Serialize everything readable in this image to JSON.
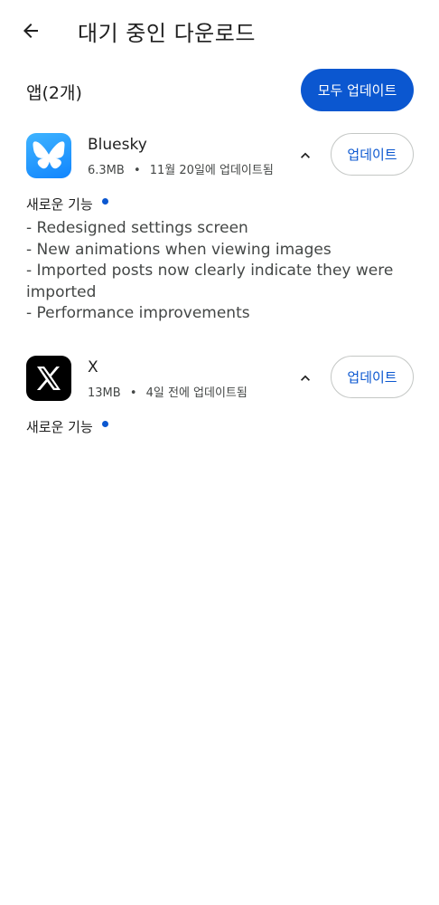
{
  "header": {
    "title": "대기 중인 다운로드"
  },
  "section": {
    "apps_count": "앱(2개)",
    "update_all_label": "모두 업데이트"
  },
  "apps": [
    {
      "name": "Bluesky",
      "size": "6.3MB",
      "updated": "11월 20일에 업데이트됨",
      "update_label": "업데이트",
      "whats_new_label": "새로운 기능",
      "notes": [
        "- Redesigned settings screen",
        "- New animations when viewing images",
        "- Imported posts now clearly indicate they were imported",
        "- Performance improvements"
      ],
      "icon": "bluesky-butterfly-icon"
    },
    {
      "name": "X",
      "size": "13MB",
      "updated": "4일 전에 업데이트됨",
      "update_label": "업데이트",
      "whats_new_label": "새로운 기능",
      "icon": "x-logo-icon"
    }
  ],
  "colors": {
    "accent": "#0b57d0",
    "text": "#1f1f1f",
    "muted": "#444746",
    "bluesky": "#1185fe"
  }
}
